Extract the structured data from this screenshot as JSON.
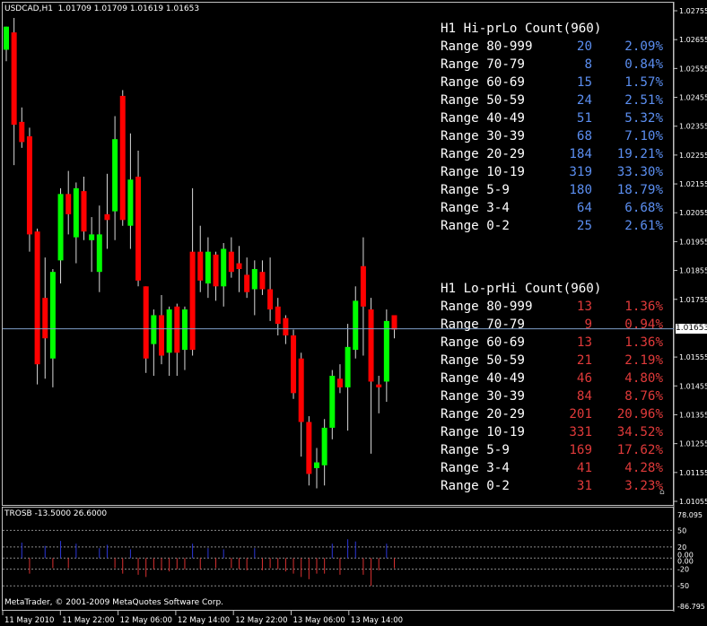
{
  "chart": {
    "header": "USDCAD,H1  1.01709 1.01709 1.01619 1.01653",
    "current_price": "1.01653",
    "current_price_value": 1.01653,
    "price_axis_labels": [
      "1.02755",
      "1.02655",
      "1.02555",
      "1.02455",
      "1.02355",
      "1.02255",
      "1.02155",
      "1.02055",
      "1.01955",
      "1.01855",
      "1.01755",
      "1.01555",
      "1.01455",
      "1.01355",
      "1.01255",
      "1.01155",
      "1.01055"
    ],
    "colors": {
      "bull": "#00ff00",
      "bear": "#ff0000",
      "wick": "#d9d9d9",
      "grid": "#c0c0c0",
      "hiprlo": "#5b8ef0",
      "loprhi": "#e03a3a",
      "price_line": "#7e9ec8"
    }
  },
  "hi_stats": {
    "title": "H1 Hi-prLo Count(960)",
    "rows": [
      {
        "label": "Range 80-999",
        "count": "20",
        "pct": "2.09%"
      },
      {
        "label": "Range 70-79",
        "count": "8",
        "pct": "0.84%"
      },
      {
        "label": "Range 60-69",
        "count": "15",
        "pct": "1.57%"
      },
      {
        "label": "Range 50-59",
        "count": "24",
        "pct": "2.51%"
      },
      {
        "label": "Range 40-49",
        "count": "51",
        "pct": "5.32%"
      },
      {
        "label": "Range 30-39",
        "count": "68",
        "pct": "7.10%"
      },
      {
        "label": "Range 20-29",
        "count": "184",
        "pct": "19.21%"
      },
      {
        "label": "Range 10-19",
        "count": "319",
        "pct": "33.30%"
      },
      {
        "label": "Range 5-9",
        "count": "180",
        "pct": "18.79%"
      },
      {
        "label": "Range 3-4",
        "count": "64",
        "pct": "6.68%"
      },
      {
        "label": "Range 0-2",
        "count": "25",
        "pct": "2.61%"
      }
    ]
  },
  "lo_stats": {
    "title": "H1 Lo-prHi Count(960)",
    "rows": [
      {
        "label": "Range 80-999",
        "count": "13",
        "pct": "1.36%"
      },
      {
        "label": "Range 70-79",
        "count": "9",
        "pct": "0.94%"
      },
      {
        "label": "Range 60-69",
        "count": "13",
        "pct": "1.36%"
      },
      {
        "label": "Range 50-59",
        "count": "21",
        "pct": "2.19%"
      },
      {
        "label": "Range 40-49",
        "count": "46",
        "pct": "4.80%"
      },
      {
        "label": "Range 30-39",
        "count": "84",
        "pct": "8.76%"
      },
      {
        "label": "Range 20-29",
        "count": "201",
        "pct": "20.96%"
      },
      {
        "label": "Range 10-19",
        "count": "331",
        "pct": "34.52%"
      },
      {
        "label": "Range 5-9",
        "count": "169",
        "pct": "17.62%"
      },
      {
        "label": "Range 3-4",
        "count": "41",
        "pct": "4.28%"
      },
      {
        "label": "Range 0-2",
        "count": "31",
        "pct": "3.23%"
      }
    ]
  },
  "indicator": {
    "header": "TROSB -13.5000 26.6000",
    "axis_labels": [
      "78.095",
      "50",
      "20",
      "0.00",
      "0.00",
      "-20",
      "-50",
      "-86.795"
    ],
    "levels": [
      50,
      20,
      0,
      -20,
      -50
    ],
    "copyright": "MetaTrader, © 2001-2009 MetaQuotes Software Corp."
  },
  "time_axis": [
    "11 May 2010",
    "11 May 22:00",
    "12 May 06:00",
    "12 May 14:00",
    "12 May 22:00",
    "13 May 06:00",
    "13 May 14:00"
  ],
  "candles": [
    [
      1.0262,
      1.027,
      1.0258,
      1.027
    ],
    [
      1.0268,
      1.0273,
      1.0222,
      1.0236
    ],
    [
      1.0237,
      1.0242,
      1.0228,
      1.023
    ],
    [
      1.0232,
      1.0235,
      1.0192,
      1.0198
    ],
    [
      1.0199,
      1.02,
      1.0146,
      1.0153
    ],
    [
      1.0176,
      1.019,
      1.0148,
      1.0162
    ],
    [
      1.0155,
      1.0186,
      1.0145,
      1.0185
    ],
    [
      1.0189,
      1.0214,
      1.0181,
      1.0212
    ],
    [
      1.0212,
      1.022,
      1.0198,
      1.0205
    ],
    [
      1.0197,
      1.0216,
      1.0188,
      1.0214
    ],
    [
      1.0213,
      1.0218,
      1.0196,
      1.0199
    ],
    [
      1.0196,
      1.0204,
      1.0185,
      1.0198
    ],
    [
      1.0185,
      1.0208,
      1.0178,
      1.0198
    ],
    [
      1.0205,
      1.0219,
      1.0193,
      1.0203
    ],
    [
      1.0206,
      1.0239,
      1.0196,
      1.0231
    ],
    [
      1.0246,
      1.0248,
      1.0201,
      1.0203
    ],
    [
      1.0201,
      1.0233,
      1.0193,
      1.0217
    ],
    [
      1.0218,
      1.0227,
      1.018,
      1.0182
    ],
    [
      1.018,
      1.018,
      1.015,
      1.0155
    ],
    [
      1.016,
      1.0172,
      1.0149,
      1.017
    ],
    [
      1.017,
      1.0177,
      1.0153,
      1.0156
    ],
    [
      1.0157,
      1.0173,
      1.0149,
      1.0172
    ],
    [
      1.0173,
      1.0174,
      1.0149,
      1.0157
    ],
    [
      1.0158,
      1.0173,
      1.0151,
      1.0172
    ],
    [
      1.0192,
      1.0214,
      1.0156,
      1.0158
    ],
    [
      1.0192,
      1.0201,
      1.0178,
      1.0182
    ],
    [
      1.0181,
      1.0197,
      1.0176,
      1.0192
    ],
    [
      1.0191,
      1.0192,
      1.0175,
      1.018
    ],
    [
      1.018,
      1.0195,
      1.0173,
      1.0193
    ],
    [
      1.0192,
      1.0197,
      1.0183,
      1.0185
    ],
    [
      1.0188,
      1.0194,
      1.0178,
      1.0186
    ],
    [
      1.0184,
      1.019,
      1.0176,
      1.0178
    ],
    [
      1.0179,
      1.0189,
      1.017,
      1.0186
    ],
    [
      1.0185,
      1.0189,
      1.0177,
      1.0179
    ],
    [
      1.0179,
      1.019,
      1.0168,
      1.0172
    ],
    [
      1.0173,
      1.0176,
      1.0163,
      1.0167
    ],
    [
      1.0169,
      1.017,
      1.016,
      1.0163
    ],
    [
      1.0163,
      1.0165,
      1.0141,
      1.0143
    ],
    [
      1.0155,
      1.0157,
      1.0121,
      1.0133
    ],
    [
      1.0133,
      1.0135,
      1.0111,
      1.0115
    ],
    [
      1.0117,
      1.0124,
      1.011,
      1.0119
    ],
    [
      1.0118,
      1.0134,
      1.0111,
      1.0131
    ],
    [
      1.0131,
      1.0151,
      1.0127,
      1.0149
    ],
    [
      1.0148,
      1.0153,
      1.0143,
      1.0145
    ],
    [
      1.0145,
      1.0167,
      1.013,
      1.0159
    ],
    [
      1.0158,
      1.018,
      1.0155,
      1.0175
    ],
    [
      1.0187,
      1.0197,
      1.0156,
      1.0173
    ],
    [
      1.0172,
      1.0176,
      1.0122,
      1.0147
    ],
    [
      1.0146,
      1.0149,
      1.0136,
      1.0145
    ],
    [
      1.0147,
      1.0172,
      1.014,
      1.0168
    ],
    [
      1.017,
      1.017,
      1.0162,
      1.0165
    ]
  ],
  "trosb_values": [
    0,
    0,
    28,
    -28,
    0,
    22,
    -18,
    31,
    -18,
    26,
    0,
    0,
    18,
    24,
    -18,
    -28,
    16,
    -30,
    -34,
    -20,
    -22,
    -24,
    -20,
    -20,
    26,
    -20,
    18,
    -18,
    16,
    -18,
    -20,
    -22,
    18,
    -22,
    -18,
    -20,
    -24,
    -28,
    -34,
    -38,
    -28,
    -28,
    26,
    -30,
    34,
    30,
    -30,
    -50,
    -22,
    26,
    -18
  ]
}
